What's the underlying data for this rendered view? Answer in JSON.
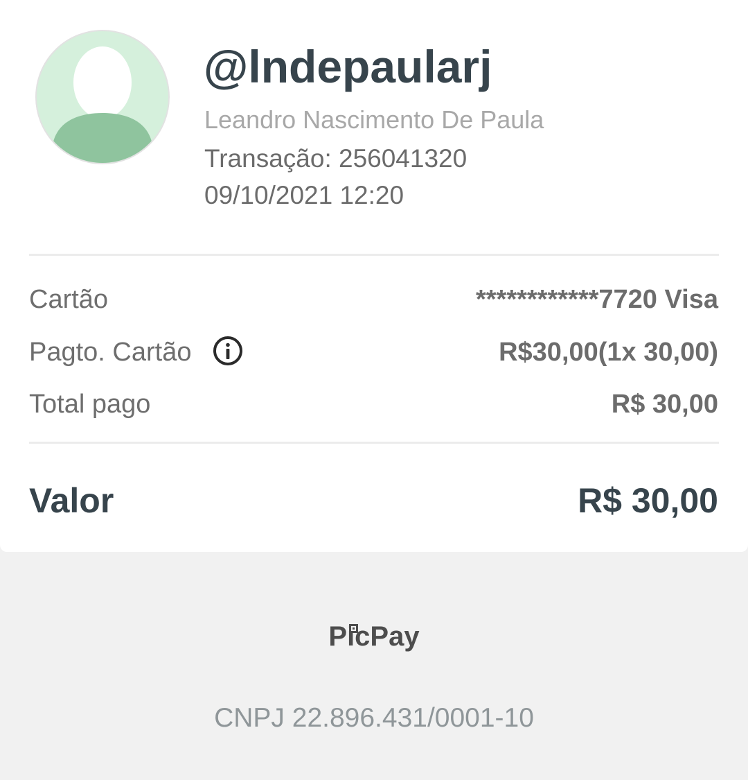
{
  "profile": {
    "username": "@lndepaularj",
    "full_name": "Leandro Nascimento De Paula",
    "transaction": "Transação: 256041320",
    "datetime": "09/10/2021 12:20",
    "avatar_icon": "person-placeholder-icon",
    "avatar_bg_color": "#d5f0dc",
    "avatar_fg_color": "#8fc49e"
  },
  "details": {
    "card_label": "Cartão",
    "card_value": "************7720 Visa",
    "payment_label": "Pagto. Cartão",
    "payment_info_icon": "info-circle-icon",
    "payment_value": "R$30,00(1x 30,00)",
    "total_label": "Total pago",
    "total_value": "R$ 30,00"
  },
  "summary": {
    "valor_label": "Valor",
    "valor_value": "R$ 30,00"
  },
  "footer": {
    "brand": "PicPay",
    "cnpj": "CNPJ 22.896.431/0001-10"
  }
}
